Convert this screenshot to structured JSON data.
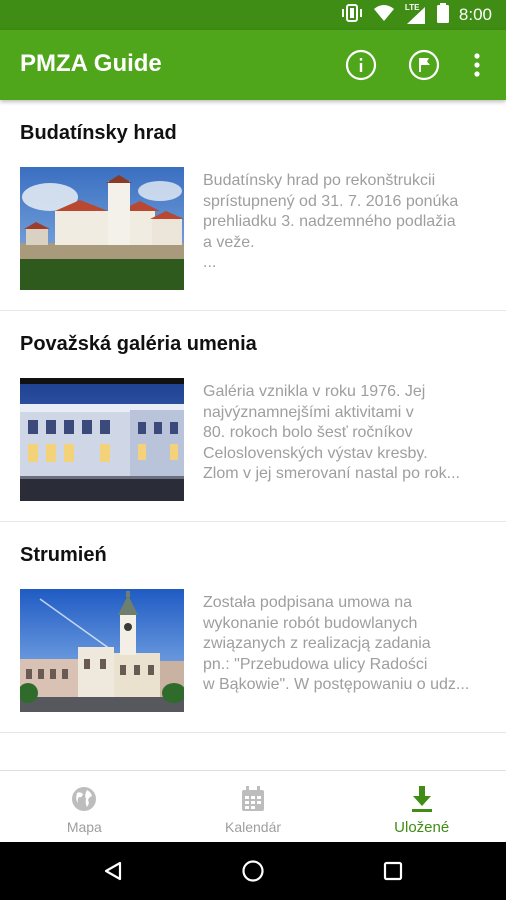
{
  "status_bar": {
    "time": "8:00",
    "network_label": "LTE"
  },
  "app_bar": {
    "title": "PMZA Guide"
  },
  "items": [
    {
      "title": "Budatínsky hrad",
      "desc_lines": [
        "Budatínsky hrad po rekonštrukcii",
        "sprístupnený od 31. 7. 2016 ponúka",
        "prehliadku 3. nadzemného podlažia",
        "a veže.",
        "..."
      ]
    },
    {
      "title": "Považská galéria umenia",
      "desc_lines": [
        "Galéria vznikla v roku 1976. Jej",
        "najvýznamnejšími aktivitami v",
        "80. rokoch bolo šesť ročníkov",
        "Celoslovenských výstav kresby.",
        "Zlom v jej smerovaní nastal po rok..."
      ]
    },
    {
      "title": "Strumień",
      "desc_lines": [
        "Została podpisana umowa na",
        "wykonanie robót budowlanych",
        "związanych z realizacją zadania",
        "pn.: \"Przebudowa ulicy Radości",
        "w Bąkowie\". W postępowaniu o udz..."
      ]
    }
  ],
  "bottom_nav": {
    "tabs": [
      {
        "label": "Mapa",
        "icon": "globe-icon"
      },
      {
        "label": "Kalendár",
        "icon": "calendar-icon"
      },
      {
        "label": "Uložené",
        "icon": "download-icon",
        "active": true
      }
    ]
  },
  "colors": {
    "accent": "#4fa61b",
    "accent_dark": "#3f8d14",
    "text_muted": "#9e9e9e"
  }
}
